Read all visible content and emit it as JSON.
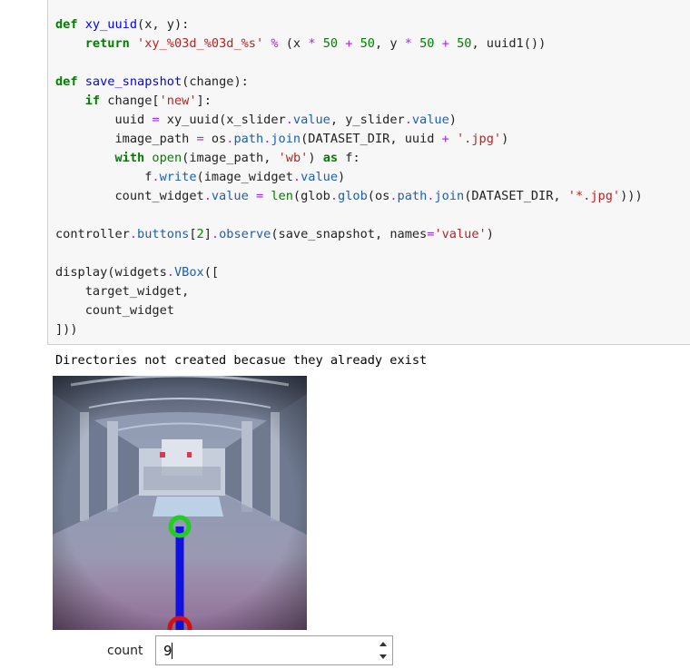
{
  "code_cell": {
    "lines": [
      "def xy_uuid(x, y):",
      "    return 'xy_%03d_%03d_%s' % (x * 50 + 50, y * 50 + 50, uuid1())",
      "",
      "def save_snapshot(change):",
      "    if change['new']:",
      "        uuid = xy_uuid(x_slider.value, y_slider.value)",
      "        image_path = os.path.join(DATASET_DIR, uuid + '.jpg')",
      "        with open(image_path, 'wb') as f:",
      "            f.write(image_widget.value)",
      "        count_widget.value = len(glob.glob(os.path.join(DATASET_DIR, '*.jpg')))",
      "",
      "controller.buttons[2].observe(save_snapshot, names='value')",
      "",
      "display(widgets.VBox([",
      "    target_widget,",
      "    count_widget",
      "]))"
    ]
  },
  "output": {
    "message": "Directories not created becasue they already exist"
  },
  "camera_view": {
    "description_icon": "camera-feed-image",
    "target_color": "#22cc22",
    "line_color": "#1010e0",
    "origin_color": "#e01010"
  },
  "count_widget": {
    "label": "count",
    "value": "9"
  }
}
